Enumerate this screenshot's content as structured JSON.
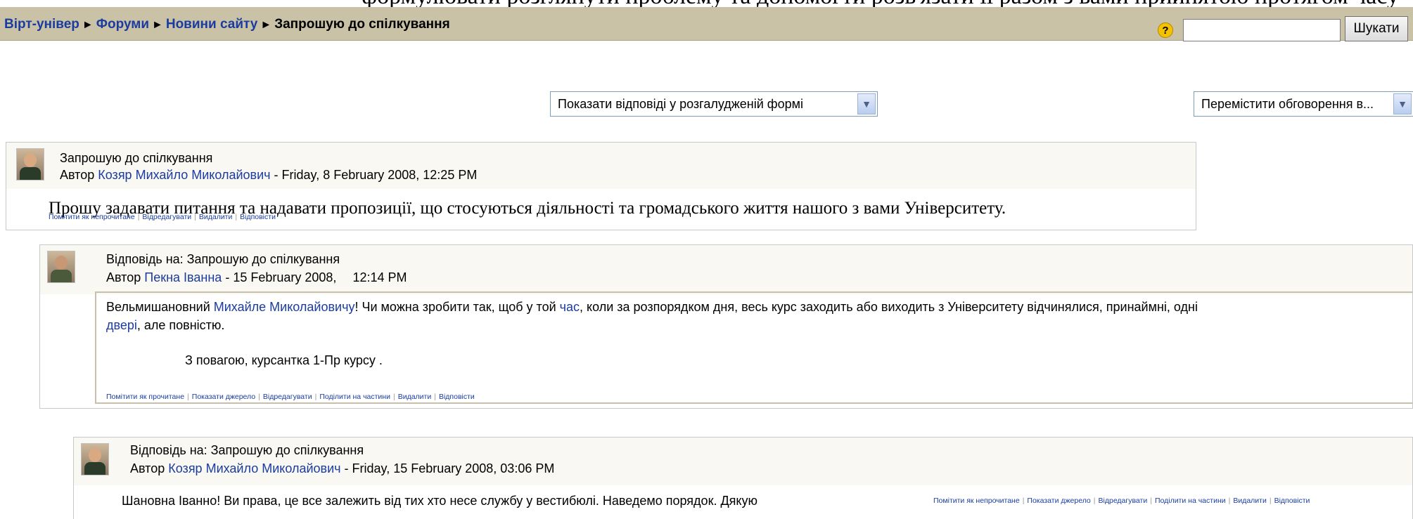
{
  "top_clipped_text": "формулювати розглянути проблему та допомогти розв'язати її разом з вами прийнятою протягом часу",
  "breadcrumb": {
    "items": [
      "Вірт-універ",
      "Форуми",
      "Новини сайту"
    ],
    "current": "Запрошую до спілкування",
    "separator": "►"
  },
  "help_icon": "?",
  "search": {
    "value": "",
    "button_label": "Шукати"
  },
  "display_mode": {
    "selected": "Показати відповіді у розгалудженій формі"
  },
  "move_discussion": {
    "selected": "Перемістити обговорення в..."
  },
  "posts": [
    {
      "subject": "Запрошую до спілкування",
      "author_prefix": "Автор",
      "author": "Козяр Михайло Миколайович",
      "date": "- Friday, 8 February 2008, 12:25 PM",
      "message": "Прошу задавати питання та надавати пропозиції, що стосуються діяльності та громадського життя нашого з вами Університету.",
      "commands": [
        "Помітити як непрочитане",
        "Відредагувати",
        "Видалити",
        "Відповісти"
      ]
    },
    {
      "subject": "Відповідь на: Запрошую до спілкування",
      "author_prefix": "Автор",
      "author": "Пекна Іванна",
      "date": "- 15 February 2008,",
      "time": "12:14 PM",
      "message_parts": {
        "p1": "Вельмишановний ",
        "link1": "Михайле Миколайовичу",
        "p2": "! Чи можна зробити так, щоб у той ",
        "link2": "час",
        "p3": ", коли за розпорядком дня, весь курс заходить або виходить з Університету відчинялися, принаймні, одні",
        "link3": "двері",
        "p4": ", але повністю."
      },
      "signature": "З повагою, курсантка 1-Пр курсу .",
      "commands": [
        "Помітити як прочитане",
        "Показати джерело",
        "Відредагувати",
        "Поділити на частини",
        "Видалити",
        "Відповісти"
      ]
    },
    {
      "subject": "Відповідь на: Запрошую до спілкування",
      "author_prefix": "Автор",
      "author": "Козяр Михайло Миколайович",
      "date": "- Friday, 15 February 2008, 03:06 PM",
      "message": "Шановна Іванно! Ви права, це все залежить від тих хто несе службу у вестибюлі. Наведемо порядок. Дякую",
      "commands": [
        "Помітити як непрочитане",
        "Показати джерело",
        "Відредагувати",
        "Поділити на частини",
        "Видалити",
        "Відповісти"
      ]
    }
  ]
}
